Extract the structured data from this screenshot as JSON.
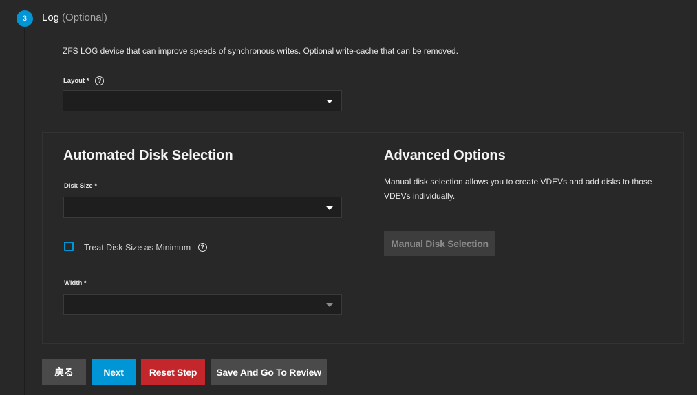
{
  "step": {
    "number": "3",
    "title": "Log",
    "optional_label": "(Optional)",
    "description": "ZFS LOG device that can improve speeds of synchronous writes. Optional write-cache that can be removed."
  },
  "layout": {
    "label": "Layout *",
    "value": ""
  },
  "automated": {
    "heading": "Automated Disk Selection",
    "disk_size_label": "Disk Size *",
    "disk_size_value": "",
    "treat_min_label": "Treat Disk Size as Minimum",
    "treat_min_checked": false,
    "width_label": "Width *",
    "width_value": ""
  },
  "advanced": {
    "heading": "Advanced Options",
    "text": "Manual disk selection allows you to create VDEVs and add disks to those VDEVs individually.",
    "manual_button": "Manual Disk Selection"
  },
  "footer": {
    "back": "戻る",
    "next": "Next",
    "reset": "Reset Step",
    "review": "Save And Go To Review"
  },
  "icons": {
    "help": "help-circle-icon",
    "dropdown": "chevron-down-icon"
  },
  "colors": {
    "accent": "#0095d5",
    "danger": "#c4272b",
    "background": "#282828",
    "input_bg": "#1e1e1e"
  }
}
